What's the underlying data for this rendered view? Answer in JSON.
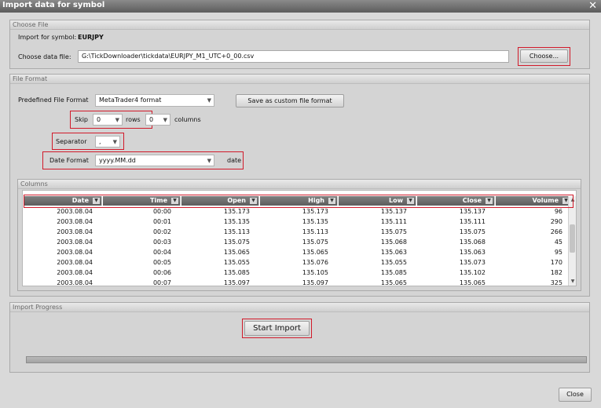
{
  "window": {
    "title": "Import data for symbol",
    "close_glyph": "✕"
  },
  "choose_file": {
    "header": "Choose File",
    "import_for_label": "Import for symbol:",
    "symbol": "EURJPY",
    "data_file_label": "Choose data file:",
    "data_file_value": "G:\\TickDownloader\\tickdata\\EURJPY_M1_UTC+0_00.csv",
    "choose_button": "Choose..."
  },
  "file_format": {
    "header": "File Format",
    "predefined_label": "Predefined File Format",
    "predefined_value": "MetaTrader4 format",
    "save_custom_button": "Save as custom file format",
    "skip_label": "Skip",
    "skip_value": "0",
    "rows_label": "rows",
    "columns_value": "0",
    "columns_label": "columns",
    "separator_label": "Separator",
    "separator_value": ",",
    "date_format_label": "Date Format",
    "date_format_value": "yyyy.MM.dd",
    "date_label": "date"
  },
  "columns": {
    "header": "Columns",
    "headers": [
      "Date",
      "Time",
      "Open",
      "High",
      "Low",
      "Close",
      "Volume"
    ],
    "rows": [
      [
        "2003.08.04",
        "00:00",
        "135.173",
        "135.173",
        "135.137",
        "135.137",
        "96"
      ],
      [
        "2003.08.04",
        "00:01",
        "135.135",
        "135.135",
        "135.111",
        "135.111",
        "290"
      ],
      [
        "2003.08.04",
        "00:02",
        "135.113",
        "135.113",
        "135.075",
        "135.075",
        "266"
      ],
      [
        "2003.08.04",
        "00:03",
        "135.075",
        "135.075",
        "135.068",
        "135.068",
        "45"
      ],
      [
        "2003.08.04",
        "00:04",
        "135.065",
        "135.065",
        "135.063",
        "135.063",
        "95"
      ],
      [
        "2003.08.04",
        "00:05",
        "135.055",
        "135.076",
        "135.055",
        "135.073",
        "170"
      ],
      [
        "2003.08.04",
        "00:06",
        "135.085",
        "135.105",
        "135.085",
        "135.102",
        "182"
      ],
      [
        "2003.08.04",
        "00:07",
        "135.097",
        "135.097",
        "135.065",
        "135.065",
        "325"
      ]
    ]
  },
  "import_progress": {
    "header": "Import Progress",
    "start_button": "Start Import",
    "progress_fraction": 0
  },
  "footer": {
    "close_button": "Close"
  },
  "colors": {
    "highlight": "#d11a2a",
    "header_dark": "#5d5d5d"
  },
  "icons": [
    "close-icon",
    "dropdown-arrow-icon",
    "scroll-up-icon",
    "scroll-down-icon"
  ]
}
